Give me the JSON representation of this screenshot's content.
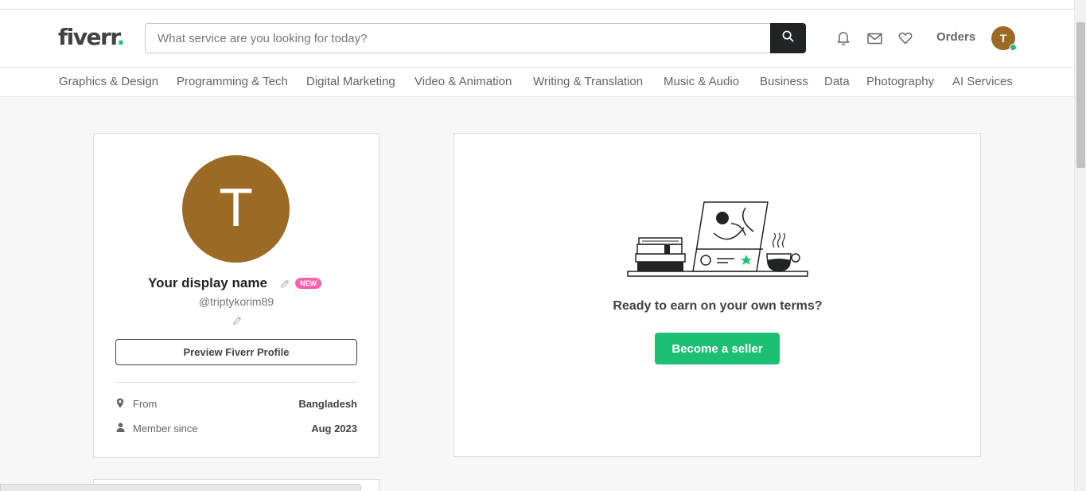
{
  "header": {
    "logo_text": "fiverr",
    "logo_dot": ".",
    "search_placeholder": "What service are you looking for today?",
    "orders_label": "Orders",
    "avatar_initial": "T"
  },
  "categories": [
    "Graphics & Design",
    "Programming & Tech",
    "Digital Marketing",
    "Video & Animation",
    "Writing & Translation",
    "Music & Audio",
    "Business",
    "Data",
    "Photography",
    "AI Services"
  ],
  "profile": {
    "avatar_initial": "T",
    "display_name": "Your display name",
    "badge": "NEW",
    "username": "@triptykorim89",
    "preview_button": "Preview Fiverr Profile",
    "from_label": "From",
    "from_value": "Bangladesh",
    "member_label": "Member since",
    "member_value": "Aug 2023"
  },
  "seller_promo": {
    "headline": "Ready to earn on your own terms?",
    "button": "Become a seller"
  },
  "colors": {
    "brand_green": "#1dbf73",
    "avatar_brown": "#9b6a25",
    "badge_pink": "#ff62ad",
    "dark": "#222325"
  }
}
